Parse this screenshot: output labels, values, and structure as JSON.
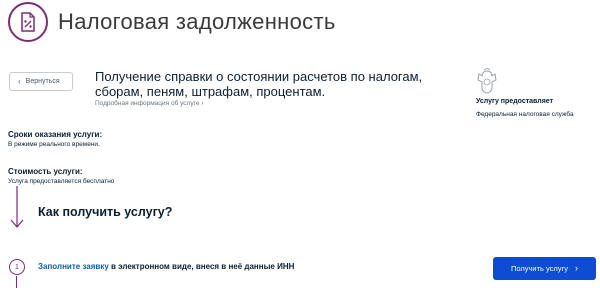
{
  "header": {
    "icon": "percent-document-icon",
    "title": "Налоговая задолженность"
  },
  "back_button": {
    "label": "Вернуться",
    "icon": "chevron-left-icon"
  },
  "service": {
    "title": "Получение справки о состоянии расчетов по налогам, сборам, пеням, штрафам, процентам.",
    "info_link": "Подробная информация об услуге"
  },
  "provider": {
    "emblem": "russian-emblem-icon",
    "label": "Услугу предоставляет",
    "name": "Федеральная налоговая служба"
  },
  "terms": {
    "label": "Сроки оказания услуги:",
    "value": "В режиме реального времени."
  },
  "cost": {
    "label": "Стоимость услуги:",
    "value": "Услуга предоставляется бесплатно"
  },
  "how_to": {
    "heading": "Как получить услугу?"
  },
  "step1": {
    "number": "1",
    "link_text": "Заполните заявку",
    "rest_text": " в электронном виде, внеся в неё данные ИНН"
  },
  "cta_button": {
    "label": "Получить услугу",
    "icon": "chevron-right-icon"
  },
  "colors": {
    "accent": "#7a2d74",
    "primary_button": "#0d4cd3",
    "link": "#0d5fa6",
    "text": "#0b1f33"
  }
}
